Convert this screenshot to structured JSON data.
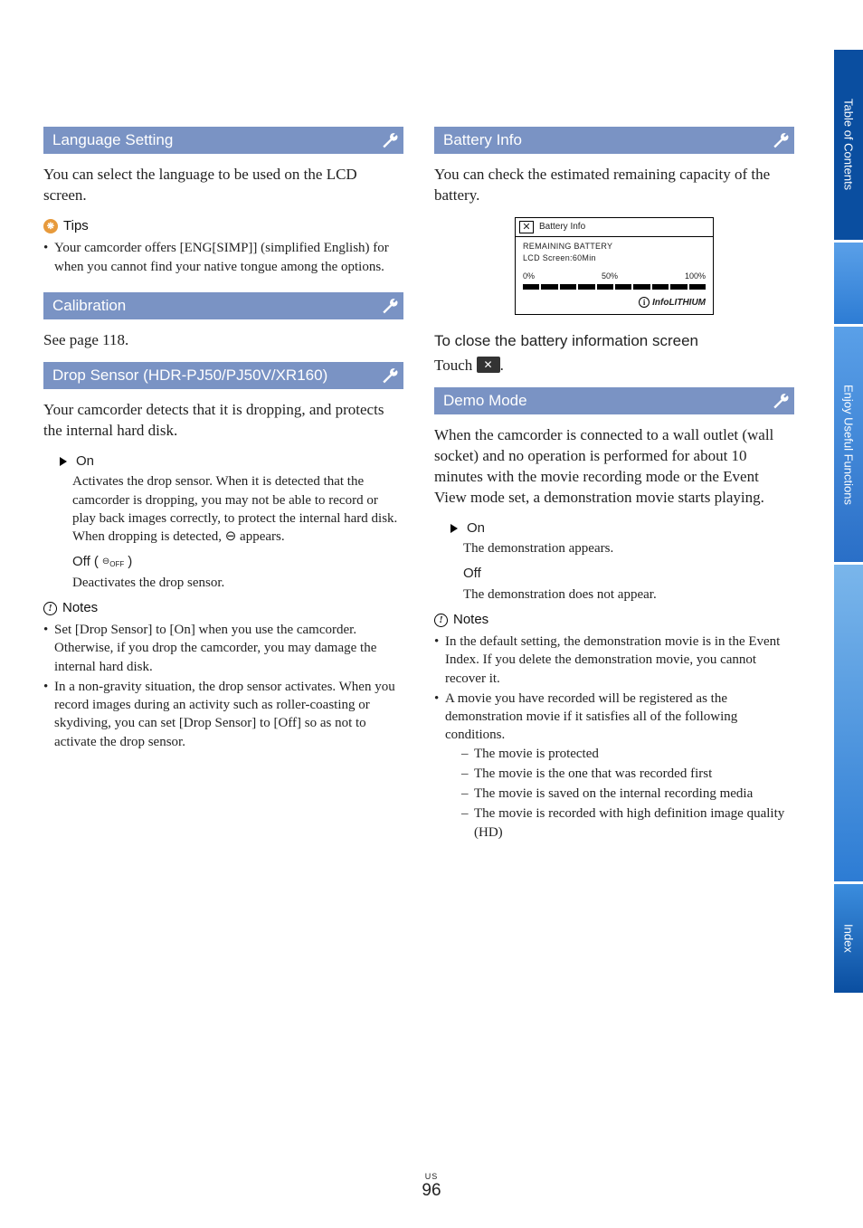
{
  "sidebar": {
    "tabs": [
      "Table of Contents",
      "Enjoy Useful Functions",
      "Index"
    ]
  },
  "left": {
    "lang": {
      "header": "Language Setting",
      "body": "You can select the language to be used on the LCD screen.",
      "tips_label": "Tips",
      "tips": [
        "Your camcorder offers [ENG[SIMP]] (simplified English) for when you cannot find your native tongue among the options."
      ]
    },
    "calib": {
      "header": "Calibration",
      "body": "See page 118."
    },
    "drop": {
      "header": "Drop Sensor (HDR-PJ50/PJ50V/XR160)",
      "body": "Your camcorder detects that it is dropping, and protects the internal hard disk.",
      "on_label": "On",
      "on_desc": "Activates the drop sensor. When it is detected that the camcorder is dropping, you may not be able to record or play back images correctly, to protect the internal hard disk. When dropping is detected, ",
      "on_desc_tail": " appears.",
      "off_label": "Off (",
      "off_suffix": ")",
      "off_icon_text": "OFF",
      "off_desc": "Deactivates the drop sensor.",
      "notes_label": "Notes",
      "notes": [
        "Set [Drop Sensor] to [On] when you use the camcorder. Otherwise, if you drop the camcorder, you may damage the internal hard disk.",
        "In a non-gravity situation, the drop sensor activates. When you record images during an activity such as roller-coasting or skydiving, you can set [Drop Sensor] to [Off] so as not to activate the drop sensor."
      ]
    }
  },
  "right": {
    "battery": {
      "header": "Battery Info",
      "body": "You can check the estimated remaining capacity of the battery.",
      "screen": {
        "title": "Battery Info",
        "remaining": "REMAINING BATTERY",
        "lcd": "LCD Screen:60Min",
        "scale": [
          "0%",
          "50%",
          "100%"
        ],
        "brand": "InfoLITHIUM"
      },
      "close_head": "To close the battery information screen",
      "close_body_pre": "Touch ",
      "close_body_post": "."
    },
    "demo": {
      "header": "Demo Mode",
      "body": "When the camcorder is connected to a wall outlet (wall socket) and no operation is performed for about 10 minutes with the movie recording mode or the Event View mode set, a demonstration movie starts playing.",
      "on_label": "On",
      "on_desc": "The demonstration appears.",
      "off_label": "Off",
      "off_desc": "The demonstration does not appear.",
      "notes_label": "Notes",
      "notes": [
        "In the default setting, the demonstration movie is in the Event Index. If you delete the demonstration movie, you cannot recover it.",
        "A movie you have recorded will be registered as the demonstration movie if it satisfies all of the following conditions."
      ],
      "conditions": [
        "The movie is protected",
        "The movie is the one that was recorded first",
        "The movie is saved on the internal recording media",
        "The movie is recorded with high definition image quality (HD)"
      ]
    }
  },
  "footer": {
    "region": "US",
    "page": "96"
  }
}
